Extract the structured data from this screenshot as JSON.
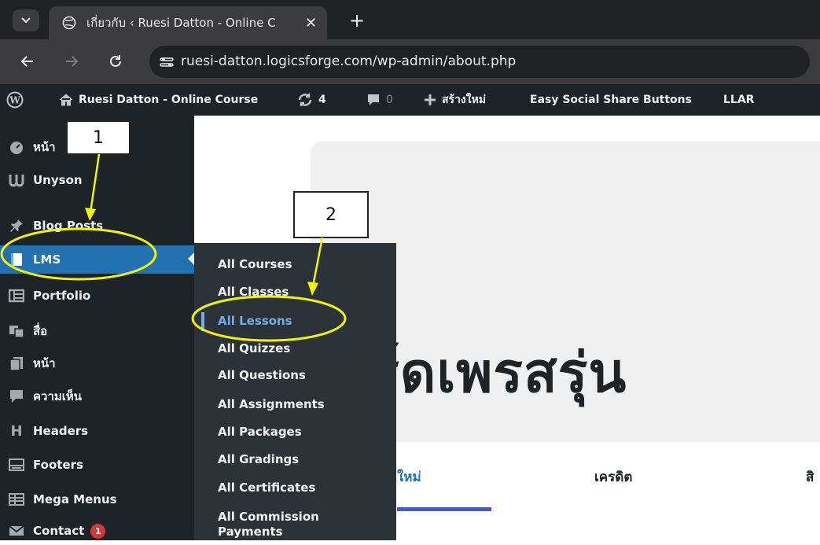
{
  "browser": {
    "tab_title": "เกี่ยวกับ ‹ Ruesi Datton - Online C",
    "tab_close": "✕",
    "new_tab": "+",
    "url": "ruesi-datton.logicsforge.com/wp-admin/about.php"
  },
  "admin_bar": {
    "site_name": "Ruesi Datton - Online Course",
    "updates_count": "4",
    "comments_count": "0",
    "new_label": "สร้างใหม่",
    "plugin_label": "Easy Social Share Buttons",
    "llar_label": "LLAR"
  },
  "sidebar": {
    "items": [
      {
        "label": "หน้า",
        "icon": "dashboard-icon"
      },
      {
        "label": "Unyson",
        "icon": "unyson-icon"
      },
      {
        "label": "Blog Posts",
        "icon": "pin-icon"
      },
      {
        "label": "LMS",
        "icon": "book-icon",
        "active": true
      },
      {
        "label": "Portfolio",
        "icon": "portfolio-icon"
      },
      {
        "label": "สื่อ",
        "icon": "media-icon"
      },
      {
        "label": "หน้า",
        "icon": "page-icon"
      },
      {
        "label": "ความเห็น",
        "icon": "comment-icon"
      },
      {
        "label": "Headers",
        "icon": "header-icon"
      },
      {
        "label": "Footers",
        "icon": "footer-icon"
      },
      {
        "label": "Mega Menus",
        "icon": "mega-menu-icon"
      },
      {
        "label": "Contact",
        "icon": "mail-icon",
        "badge": "1"
      }
    ]
  },
  "submenu": {
    "items": [
      {
        "label": "All Courses"
      },
      {
        "label": "All Classes"
      },
      {
        "label": "All Lessons",
        "current": true
      },
      {
        "label": "All Quizzes"
      },
      {
        "label": "All Questions"
      },
      {
        "label": "All Assignments"
      },
      {
        "label": "All Packages"
      },
      {
        "label": "All Gradings"
      },
      {
        "label": "All Certificates"
      },
      {
        "label": "All Commission Payments"
      }
    ]
  },
  "main": {
    "hero_title": "วิร์ดเพรสรุ่น",
    "tabs": [
      "ใหม่",
      "เครดิต",
      "สิ"
    ]
  },
  "annotations": {
    "callout_1": "1",
    "callout_2": "2",
    "highlight_color": "#f2f20a"
  },
  "colors": {
    "admin_dark": "#1d2327",
    "active_blue": "#2271b1",
    "current_link": "#72aee6"
  }
}
